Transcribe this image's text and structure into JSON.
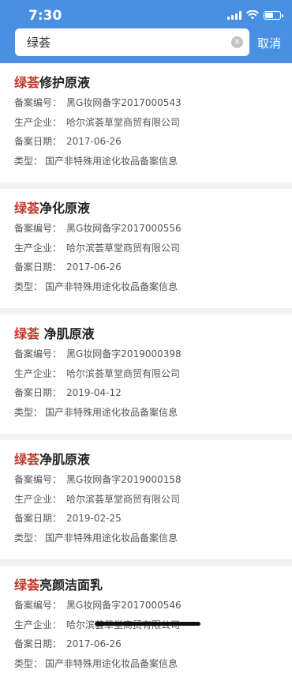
{
  "status_bar": {
    "time": "7:30"
  },
  "search": {
    "value": "绿荟",
    "cancel_label": "取消"
  },
  "results": [
    {
      "highlight": "绿荟",
      "rest": "修护原液",
      "fields": [
        {
          "key": "备案编号：",
          "value": "黑G妆网备字2017000543"
        },
        {
          "key": "生产企业：",
          "value": "哈尔滨荟草堂商贸有限公司"
        },
        {
          "key": "备案日期：",
          "value": "2017-06-26"
        },
        {
          "key": "类型：",
          "value": "国产非特殊用途化妆品备案信息"
        }
      ]
    },
    {
      "highlight": "绿荟",
      "rest": "净化原液",
      "fields": [
        {
          "key": "备案编号：",
          "value": "黑G妆网备字2017000556"
        },
        {
          "key": "生产企业：",
          "value": "哈尔滨荟草堂商贸有限公司"
        },
        {
          "key": "备案日期：",
          "value": "2017-06-26"
        },
        {
          "key": "类型：",
          "value": "国产非特殊用途化妆品备案信息"
        }
      ]
    },
    {
      "highlight": "绿荟",
      "rest": " 净肌原液",
      "fields": [
        {
          "key": "备案编号：",
          "value": "黑G妆网备字2019000398"
        },
        {
          "key": "生产企业：",
          "value": "哈尔滨荟草堂商贸有限公司"
        },
        {
          "key": "备案日期：",
          "value": "2019-04-12"
        },
        {
          "key": "类型：",
          "value": "国产非特殊用途化妆品备案信息"
        }
      ]
    },
    {
      "highlight": "绿荟",
      "rest": "净肌原液",
      "fields": [
        {
          "key": "备案编号：",
          "value": "黑G妆网备字2019000158"
        },
        {
          "key": "生产企业：",
          "value": "哈尔滨荟草堂商贸有限公司"
        },
        {
          "key": "备案日期：",
          "value": "2019-02-25"
        },
        {
          "key": "类型：",
          "value": "国产非特殊用途化妆品备案信息"
        }
      ]
    },
    {
      "highlight": "绿荟",
      "rest": "亮颜洁面乳",
      "fields": [
        {
          "key": "备案编号：",
          "value": "黑G妆网备字2017000546"
        },
        {
          "key": "生产企业：",
          "value": "哈尔滨荟草堂商贸有限公司"
        },
        {
          "key": "备案日期：",
          "value": "2017-06-26"
        },
        {
          "key": "类型：",
          "value": "国产非特殊用途化妆品备案信息"
        }
      ]
    }
  ],
  "colors": {
    "header": "#4a90e2",
    "highlight": "#c0392b"
  }
}
